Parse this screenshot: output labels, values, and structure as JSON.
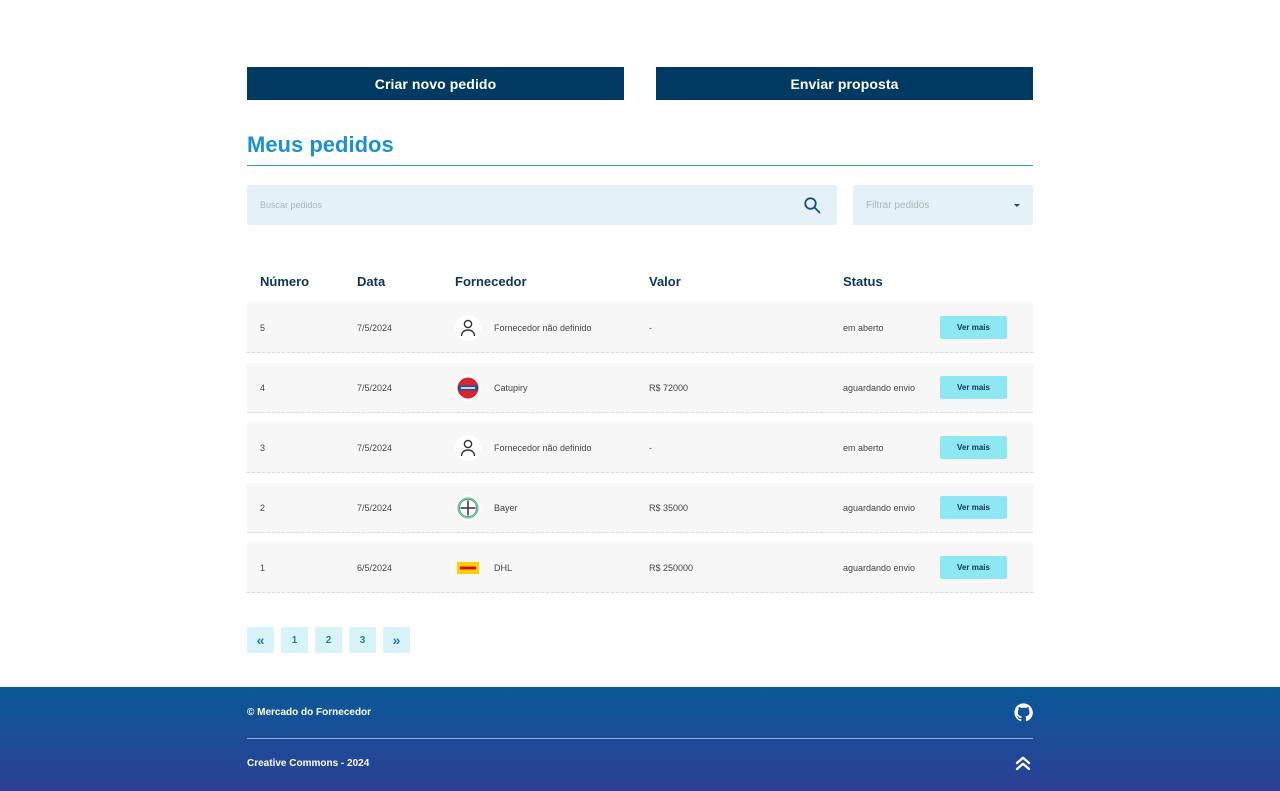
{
  "actions": {
    "create_label": "Criar novo pedido",
    "send_label": "Enviar proposta"
  },
  "section": {
    "title": "Meus pedidos"
  },
  "search": {
    "placeholder": "Buscar pedidos",
    "icon": "search-icon"
  },
  "filter": {
    "placeholder": "Filtrar pedidos",
    "icon": "caret-down-icon"
  },
  "table": {
    "headers": [
      "Número",
      "Data",
      "Fornecedor",
      "Valor",
      "Status"
    ],
    "rows": [
      {
        "number": "5",
        "date": "7/5/2024",
        "supplier": "Fornecedor não definido",
        "logo": "user-icon",
        "value": "-",
        "status": "em aberto",
        "action": "Ver mais"
      },
      {
        "number": "4",
        "date": "7/5/2024",
        "supplier": "Catupiry",
        "logo": "catupiry-logo",
        "value": "R$ 72000",
        "status": "aguardando envio",
        "action": "Ver mais"
      },
      {
        "number": "3",
        "date": "7/5/2024",
        "supplier": "Fornecedor não definido",
        "logo": "user-icon",
        "value": "-",
        "status": "em aberto",
        "action": "Ver mais"
      },
      {
        "number": "2",
        "date": "7/5/2024",
        "supplier": "Bayer",
        "logo": "bayer-logo",
        "value": "R$ 35000",
        "status": "aguardando envio",
        "action": "Ver mais"
      },
      {
        "number": "1",
        "date": "6/5/2024",
        "supplier": "DHL",
        "logo": "dhl-logo",
        "value": "R$ 250000",
        "status": "aguardando envio",
        "action": "Ver mais"
      }
    ]
  },
  "pagination": {
    "first": "«",
    "pages": [
      "1",
      "2",
      "3"
    ],
    "last": "»"
  },
  "footer": {
    "copyright": "© Mercado do Fornecedor",
    "license": "Creative Commons - 2024",
    "github_icon": "github-icon",
    "top_icon": "chevrons-up-icon"
  },
  "colors": {
    "primary": "#003a63",
    "accent": "#1b92cf",
    "button_light": "#8ee8f4",
    "input_bg": "#e4f1f6"
  }
}
